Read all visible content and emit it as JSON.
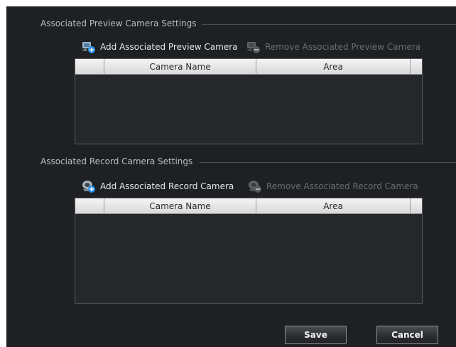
{
  "preview": {
    "title": "Associated Preview Camera Settings",
    "add_label": "Add Associated Preview Camera",
    "remove_label": "Remove Associated Preview Camera",
    "columns": [
      "",
      "Camera Name",
      "Area",
      ""
    ]
  },
  "record": {
    "title": "Associated Record  Camera Settings",
    "add_label": "Add Associated Record  Camera",
    "remove_label": "Remove Associated Record  Camera",
    "columns": [
      "",
      "Camera Name",
      "Area",
      ""
    ]
  },
  "footer": {
    "save_label": "Save",
    "cancel_label": "Cancel"
  },
  "colors": {
    "panel_bg": "#1e2023",
    "grid_bg": "#25272b",
    "header_bg": "#e8e8e8",
    "accent_blue": "#2a8ee6"
  }
}
